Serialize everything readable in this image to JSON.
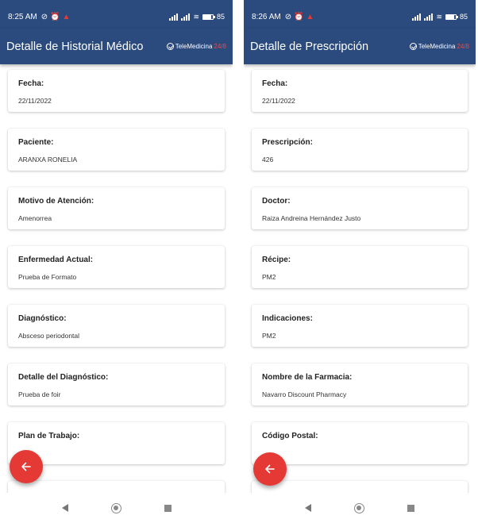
{
  "screens": [
    {
      "status": {
        "time": "8:25 AM",
        "battery": "85"
      },
      "app_bar": {
        "title": "Detalle de Historial Médico",
        "brand_main": "TeleMedicina",
        "brand_accent": "24/8"
      },
      "cards": [
        {
          "label": "Fecha:",
          "value": "22/11/2022"
        },
        {
          "label": "Paciente:",
          "value": "ARANXA RONELIA"
        },
        {
          "label": "Motivo de Atención:",
          "value": "Amenorrea"
        },
        {
          "label": "Enfermedad Actual:",
          "value": "Prueba de Formato"
        },
        {
          "label": "Diagnóstico:",
          "value": "Absceso periodontal"
        },
        {
          "label": "Detalle del Diagnóstico:",
          "value": "Prueba de foir"
        },
        {
          "label": "Plan de Trabajo:",
          "value": ""
        }
      ]
    },
    {
      "status": {
        "time": "8:26 AM",
        "battery": "85"
      },
      "app_bar": {
        "title": "Detalle de Prescripción",
        "brand_main": "TeleMedicina",
        "brand_accent": "24/8"
      },
      "cards": [
        {
          "label": "Fecha:",
          "value": "22/11/2022"
        },
        {
          "label": "Prescripción:",
          "value": "426"
        },
        {
          "label": "Doctor:",
          "value": "Raiza Andreina Hernández Justo"
        },
        {
          "label": "Récipe:",
          "value": "PM2"
        },
        {
          "label": "Indicaciones:",
          "value": "PM2"
        },
        {
          "label": "Nombre de la Farmacia:",
          "value": "Navarro Discount Pharmacy"
        },
        {
          "label": "Código Postal:",
          "value": ""
        }
      ]
    }
  ],
  "icons": {
    "status": [
      "no-disturb-icon",
      "alarm-icon",
      "alert-icon",
      "signal-icon",
      "wifi-icon",
      "battery-icon"
    ],
    "fab": "arrow-left-icon",
    "nav": [
      "nav-back-icon",
      "nav-home-icon",
      "nav-recent-icon"
    ]
  },
  "colors": {
    "primary": "#2b4a7d",
    "fab": "#e53935",
    "brand_accent": "#e64a4a",
    "card_bg": "#ffffff"
  }
}
